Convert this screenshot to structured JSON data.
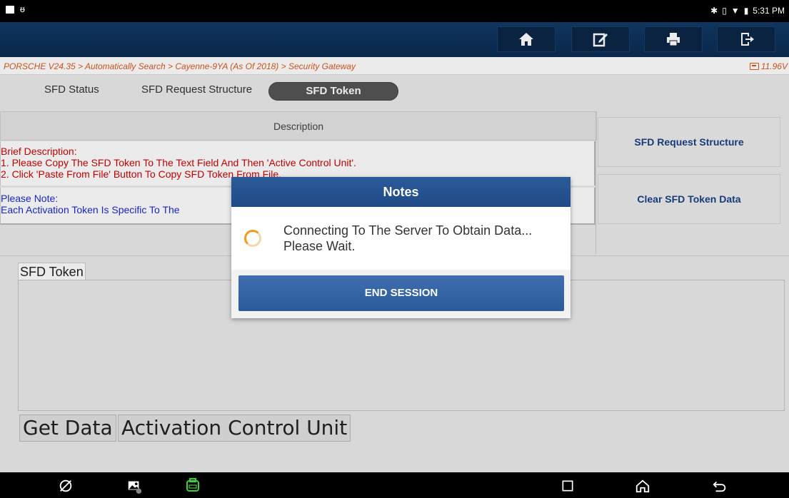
{
  "status_bar": {
    "time": "5:31 PM"
  },
  "toolbar": {
    "icons": [
      "home-icon",
      "edit-icon",
      "print-icon",
      "exit-icon"
    ],
    "bg_color": "#0b2b52"
  },
  "breadcrumb": {
    "path": "PORSCHE V24.35 > Automatically Search > Cayenne-9YA (As Of 2018) > Security Gateway",
    "voltage": "11.96V"
  },
  "tabs": [
    {
      "label": "SFD Status",
      "active": false
    },
    {
      "label": "SFD Request Structure",
      "active": false
    },
    {
      "label": "SFD Token",
      "active": true
    }
  ],
  "description": {
    "header": "Description",
    "brief_title": "Brief Description:",
    "brief_line1": "1. Please Copy The SFD Token To The Text Field And Then 'Active Control Unit'.",
    "brief_line2": "2. Click 'Paste From File' Button To Copy SFD Token From File.",
    "note_title": "Please Note:",
    "note_line": "Each Activation Token Is Specific To The"
  },
  "right_buttons": {
    "request_structure": "SFD Request Structure",
    "clear_token": "Clear SFD Token Data"
  },
  "token_panel": {
    "label": "SFD Token",
    "value": "",
    "get_data_button": "Get Data",
    "activation_button": "Activation Control Unit"
  },
  "dialog": {
    "title": "Notes",
    "message": "Connecting To The Server To Obtain Data... Please Wait.",
    "end_button": "END SESSION"
  },
  "colors": {
    "accent_orange": "#e0581c",
    "brief_red": "#d40000",
    "note_blue": "#1c2ad8",
    "dialog_blue": "#2a5a98"
  }
}
